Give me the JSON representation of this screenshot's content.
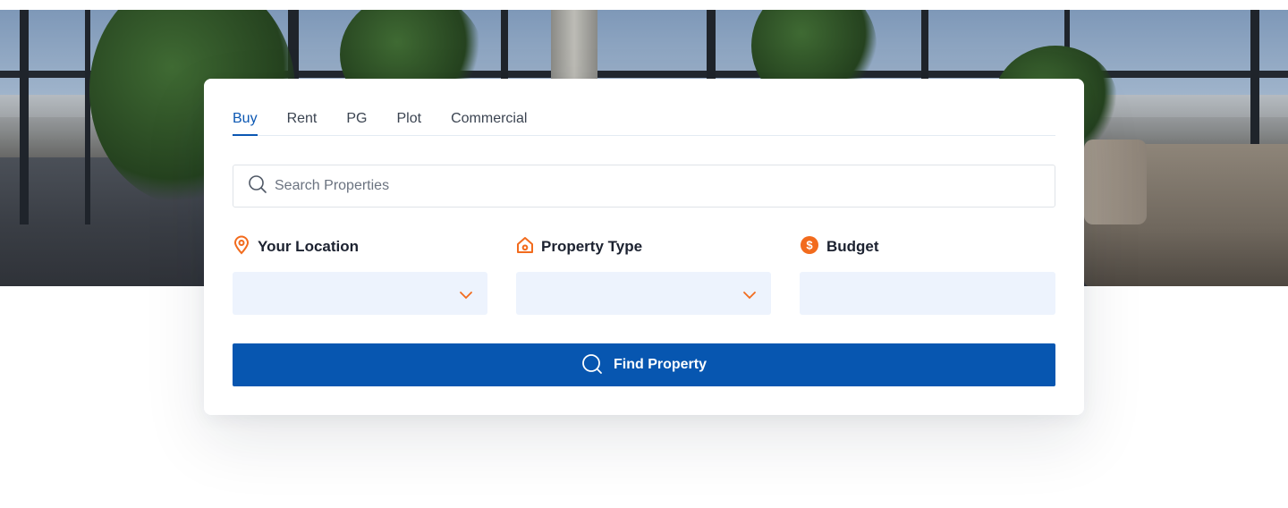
{
  "hero": {
    "image": "office-interior-photo"
  },
  "tabs": [
    {
      "label": "Buy",
      "active": true
    },
    {
      "label": "Rent",
      "active": false
    },
    {
      "label": "PG",
      "active": false
    },
    {
      "label": "Plot",
      "active": false
    },
    {
      "label": "Commercial",
      "active": false
    }
  ],
  "search": {
    "placeholder": "Search Properties",
    "value": "",
    "icon": "search-icon"
  },
  "fields": {
    "location": {
      "label": "Your Location",
      "icon": "location-pin-icon",
      "value": ""
    },
    "property_type": {
      "label": "Property Type",
      "icon": "home-icon",
      "value": ""
    },
    "budget": {
      "label": "Budget",
      "icon": "dollar-icon",
      "value": ""
    }
  },
  "find_button": {
    "label": "Find Property",
    "icon": "search-icon"
  },
  "colors": {
    "primary": "#0756b0",
    "accent": "#f26b1d",
    "input_bg": "#edf3fd",
    "tab_active": "#0b57b3"
  }
}
